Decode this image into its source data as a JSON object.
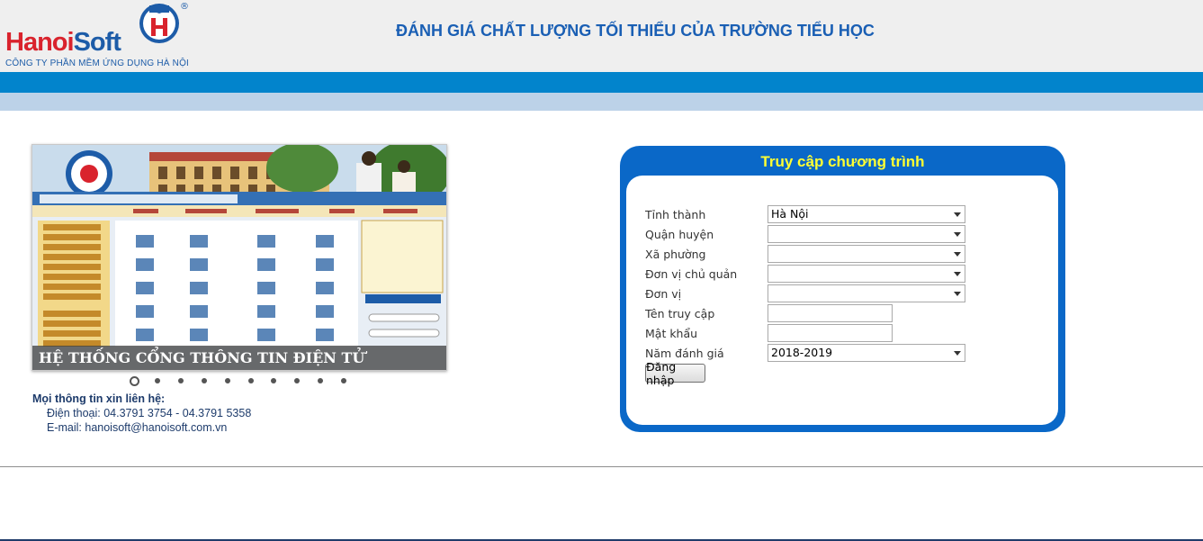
{
  "header": {
    "logo": {
      "part1": "Hanoi",
      "part2": "Soft",
      "registered": "®",
      "subtitle": "CÔNG TY PHẦN MỀM ỨNG DỤNG HÀ NỘI"
    },
    "title": "ĐÁNH GIÁ CHẤT LƯỢNG TỐI THIỂU CỦA TRƯỜNG TIỂU HỌC"
  },
  "slider": {
    "caption": "HỆ THỐNG CỔNG THÔNG TIN ĐIỆN TỬ",
    "slide_count": 10,
    "active_index": 0
  },
  "contact": {
    "heading": "Mọi thông tin xin liên hệ:",
    "phone": "Điện thoại: 04.3791 3754 - 04.3791 5358",
    "email": "E-mail: hanoisoft@hanoisoft.com.vn"
  },
  "login": {
    "title": "Truy cập chương trình",
    "fields": {
      "province": {
        "label": "Tỉnh thành",
        "value": "Hà Nội"
      },
      "district": {
        "label": "Quận huyện",
        "value": ""
      },
      "ward": {
        "label": "Xã phường",
        "value": ""
      },
      "managing_unit": {
        "label": "Đơn vị chủ quản",
        "value": ""
      },
      "unit": {
        "label": "Đơn vị",
        "value": ""
      },
      "username": {
        "label": "Tên truy cập",
        "value": ""
      },
      "password": {
        "label": "Mật khẩu",
        "value": ""
      },
      "year": {
        "label": "Năm đánh giá",
        "value": "2018-2019"
      }
    },
    "submit_label": "Đăng nhập"
  },
  "colors": {
    "header_bg": "#efefef",
    "title_blue": "#1a5fb4",
    "bar_dark": "#0284cc",
    "bar_light": "#bcd2e8",
    "panel_blue": "#0a68c8",
    "panel_title": "#ffff33",
    "logo_red": "#d9232d",
    "logo_blue": "#1d5ca8"
  }
}
